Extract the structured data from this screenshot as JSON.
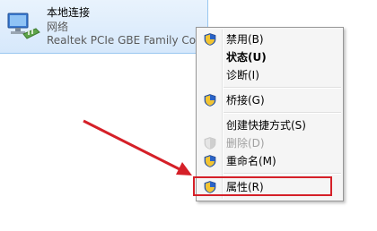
{
  "adapter": {
    "name": "本地连接",
    "status": "网络",
    "device": "Realtek PCIe GBE Family Contr"
  },
  "context_menu": {
    "items": [
      {
        "label": "禁用(B)",
        "icon": "uac-shield-icon"
      },
      {
        "label": "状态(U)",
        "icon": null,
        "bold": true
      },
      {
        "label": "诊断(I)",
        "icon": null
      },
      {
        "label": "桥接(G)",
        "icon": "uac-shield-icon"
      },
      {
        "label": "创建快捷方式(S)",
        "icon": null
      },
      {
        "label": "删除(D)",
        "icon": "uac-shield-icon",
        "disabled": true
      },
      {
        "label": "重命名(M)",
        "icon": "uac-shield-icon"
      },
      {
        "label": "属性(R)",
        "icon": "uac-shield-icon",
        "highlighted": true
      }
    ]
  },
  "colors": {
    "annotation": "#d52028",
    "selection": "#d6e8fb"
  }
}
